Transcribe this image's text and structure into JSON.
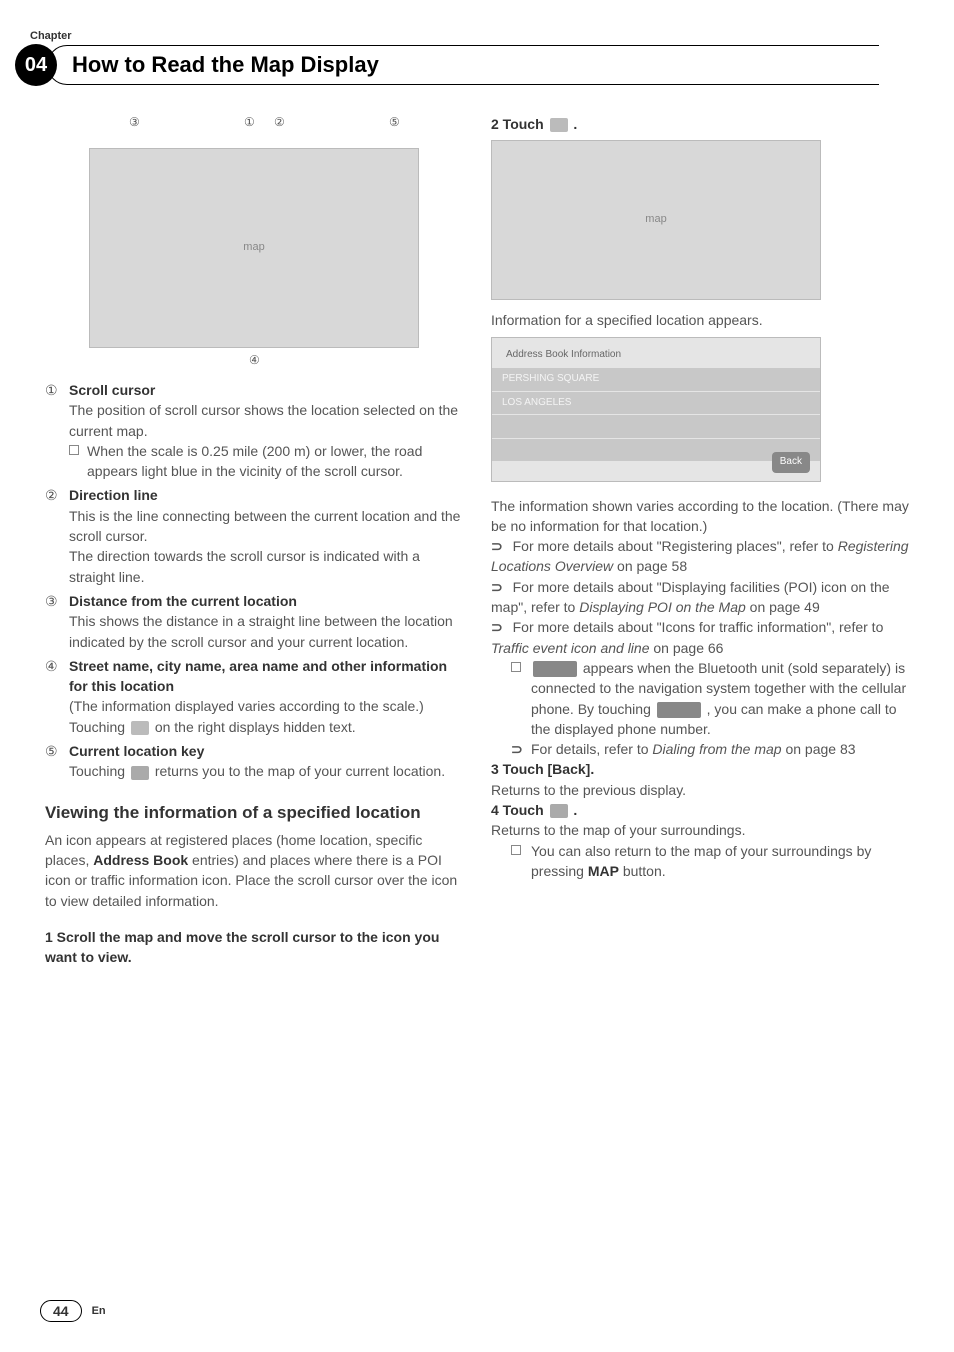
{
  "chapter": {
    "label": "Chapter",
    "number": "04",
    "title": "How to Read the Map Display"
  },
  "left": {
    "items": [
      {
        "num": "①",
        "title": "Scroll cursor",
        "body": "The position of scroll cursor shows the location selected on the current map.",
        "sub": "When the scale is 0.25 mile (200 m) or lower, the road appears light blue in the vicinity of the scroll cursor."
      },
      {
        "num": "②",
        "title": "Direction line",
        "body": "This is the line connecting between the current location and the scroll cursor.",
        "body2": "The direction towards the scroll cursor is indicated with a straight line."
      },
      {
        "num": "③",
        "title": "Distance from the current location",
        "body": "This shows the distance in a straight line between the location indicated by the scroll cursor and your current location."
      },
      {
        "num": "④",
        "title": "Street name, city name, area name and other information for this location",
        "body": "(The information displayed varies according to the scale.)",
        "body2_pre": "Touching ",
        "body2_post": " on the right displays hidden text."
      },
      {
        "num": "⑤",
        "title": "Current location key",
        "body_pre": "Touching ",
        "body_post": " returns you to the map of your current location."
      }
    ],
    "section_title": "Viewing the information of a specified location",
    "section_body_1": "An icon appears at registered places (home location, specific places, ",
    "section_body_bold": "Address Book",
    "section_body_2": " entries) and places where there is a POI icon or traffic information icon. Place the scroll cursor over the icon to view detailed information.",
    "step1": "1   Scroll the map and move the scroll cursor to the icon you want to view."
  },
  "right": {
    "step2_pre": "2   Touch ",
    "step2_post": ".",
    "caption1": "Information for a specified location appears.",
    "info_header": "Address Book Information",
    "info_row1": "PERSHING SQUARE",
    "info_row2": "LOS ANGELES",
    "info_back": "Back",
    "para1": "The information shown varies according to the location. (There may be no information for that location.)",
    "bullets": [
      {
        "pre": "For more details about \"Registering places\", refer to ",
        "it": "Registering Locations Overview",
        "post": " on page 58"
      },
      {
        "pre": "For more details about \"Displaying facilities (POI) icon on the map\", refer to ",
        "it": "Displaying POI on the Map",
        "post": " on page 49"
      },
      {
        "pre": "For more details about \"Icons for traffic information\", refer to ",
        "it": "Traffic event icon and line",
        "post": " on page 66"
      }
    ],
    "nested_pre": " appears when the Bluetooth unit (sold separately) is connected to the navigation system together with the cellular phone. By touching ",
    "nested_post": ", you can make a phone call to the displayed phone number.",
    "nested_ref_pre": "For details, refer to ",
    "nested_ref_it": "Dialing from the map",
    "nested_ref_post": " on page 83",
    "step3": "3   Touch [Back].",
    "step3_body": "Returns to the previous display.",
    "step4_pre": "4   Touch ",
    "step4_post": ".",
    "step4_body": "Returns to the map of your surroundings.",
    "step4_sub_pre": "You can also return to the map of your surroundings by pressing ",
    "step4_sub_bold": "MAP",
    "step4_sub_post": " button."
  },
  "callouts": {
    "c1": "①",
    "c2": "②",
    "c3": "③",
    "c4": "④",
    "c5": "⑤"
  },
  "footer": {
    "page": "44",
    "lang": "En"
  }
}
